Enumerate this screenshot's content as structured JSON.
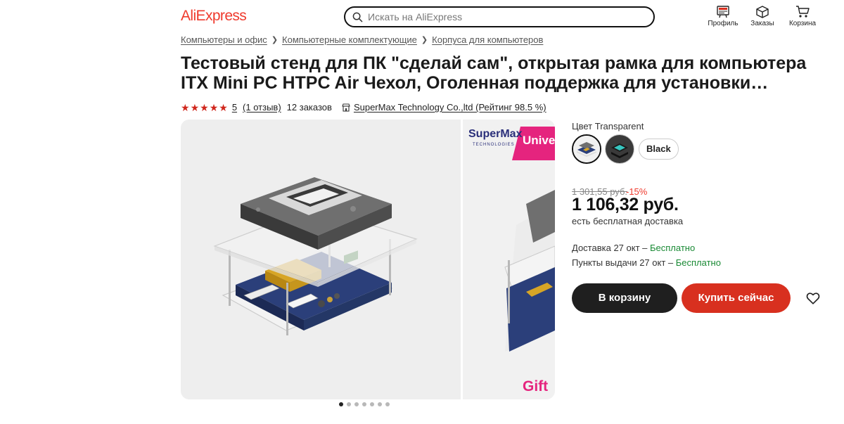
{
  "header": {
    "logo": "AliExpress",
    "search_placeholder": "Искать на AliExpress",
    "nav": [
      {
        "label": "Профиль",
        "icon": "profile-icon"
      },
      {
        "label": "Заказы",
        "icon": "box-icon"
      },
      {
        "label": "Корзина",
        "icon": "cart-icon"
      }
    ]
  },
  "breadcrumbs": [
    "Компьютеры и офис",
    "Компьютерные комплектующие",
    "Корпуса для компьютеров"
  ],
  "product": {
    "title": "Тестовый стенд для ПК \"сделай сам\", открытая рамка для компьютера ITX Mini PC HTPC Air Чехол, Оголенная поддержка для установки жесткого…",
    "rating": "5",
    "reviews": "(1 отзыв)",
    "orders": "12 заказов",
    "store": "SuperMax Technology Co.,ltd (Рейтинг 98.5 %)",
    "gallery_next_brand": "SuperMax",
    "gallery_next_brand_sub": "TECHNOLOGIES",
    "gallery_next_banner": "Unive",
    "gallery_next_bottom": "Gift",
    "image_count": 7,
    "active_image": 0
  },
  "options": {
    "color_label": "Цвет Transparent",
    "black_label": "Black"
  },
  "pricing": {
    "old_price": "1 301,55 руб.",
    "discount": "-15%",
    "price": "1 106,32 руб.",
    "free_shipping": "есть бесплатная доставка",
    "delivery_prefix": "Доставка 27 окт – ",
    "delivery_value": "Бесплатно",
    "pickup_prefix": "Пункты выдачи 27 окт – ",
    "pickup_value": "Бесплатно"
  },
  "actions": {
    "add_to_cart": "В корзину",
    "buy_now": "Купить сейчас"
  },
  "colors": {
    "brand": "#ef3a2d",
    "buy": "#d8301f",
    "dark": "#1f1f1f",
    "green": "#1a8a35",
    "magenta": "#e5247e"
  }
}
